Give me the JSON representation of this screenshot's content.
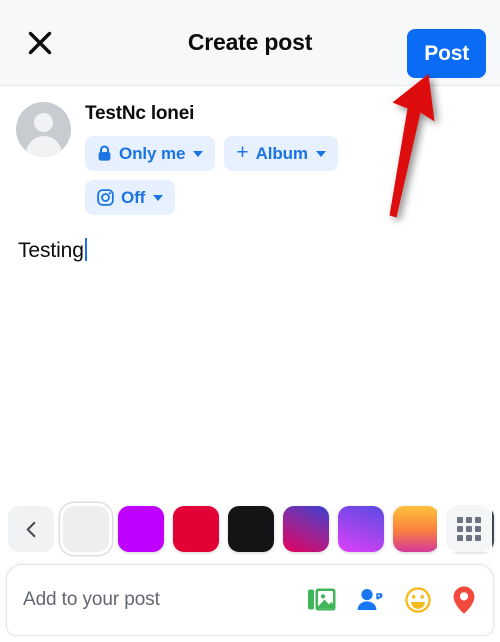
{
  "header": {
    "title": "Create post",
    "close_icon": "close-icon",
    "post_label": "Post",
    "post_color": "#0a6cf5",
    "background": "#f7f8fa"
  },
  "author": {
    "name": "TestNc lonei",
    "avatar_icon": "default-user-avatar",
    "pills": [
      {
        "id": "audience",
        "icon": "lock-icon",
        "label": "Only me",
        "caret": true
      },
      {
        "id": "album",
        "icon": "plus-icon",
        "label": "Album",
        "caret": true
      },
      {
        "id": "instagram-crosspost",
        "icon": "instagram-camera-icon",
        "label": "Off",
        "caret": true
      }
    ],
    "pill_bg": "#e7f0fe",
    "pill_fg": "#1b74e4"
  },
  "composer": {
    "text": "Testing",
    "caret_color": "#1b74e4"
  },
  "background_picker": {
    "back_icon": "chevron-left-icon",
    "grid_icon": "grid-3x3-icon",
    "swatches": [
      {
        "id": "none",
        "type": "solid",
        "color": "#eceef0",
        "selected": true
      },
      {
        "id": "magenta",
        "type": "solid",
        "color": "#bf00ff",
        "selected": false
      },
      {
        "id": "crimson",
        "type": "solid",
        "color": "#e30235",
        "selected": false
      },
      {
        "id": "black",
        "type": "solid",
        "color": "#141416",
        "selected": false
      },
      {
        "id": "purple-pink-gradient",
        "type": "gradient",
        "from": "#3a3fd0",
        "to": "#e3005e",
        "selected": false
      },
      {
        "id": "violet-gradient",
        "type": "gradient",
        "from": "#5a4ae3",
        "to": "#e040fb",
        "selected": false
      },
      {
        "id": "orange-pink-gradient",
        "type": "gradient",
        "from": "#ffc23d",
        "to": "#d6399a",
        "selected": false
      },
      {
        "id": "slate",
        "type": "solid",
        "color": "#3e4654",
        "selected": false
      }
    ]
  },
  "bottom_bar": {
    "label": "Add to your post",
    "actions": [
      {
        "id": "photo",
        "icon": "photo-gallery-icon",
        "color": "#41b658"
      },
      {
        "id": "tag-people",
        "icon": "tag-person-icon",
        "color": "#1877f2"
      },
      {
        "id": "feeling",
        "icon": "smiley-face-icon",
        "color": "#f5bb1d"
      },
      {
        "id": "location",
        "icon": "location-pin-icon",
        "color": "#f4493d"
      }
    ]
  },
  "annotation": {
    "arrow_icon": "red-arrow-pointing-to-post-button",
    "color": "#dd0b0b"
  }
}
